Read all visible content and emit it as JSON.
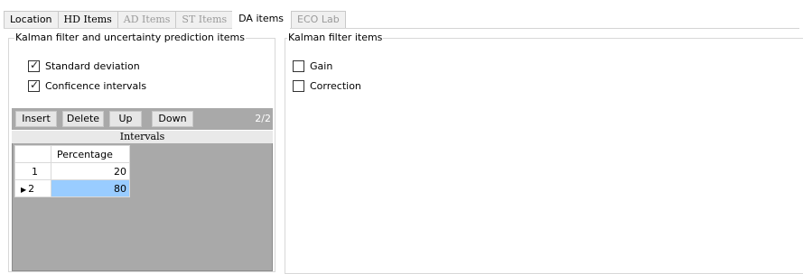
{
  "tabs": [
    {
      "label": "Location",
      "disabled": false,
      "serif": false
    },
    {
      "label": "HD Items",
      "disabled": false,
      "serif": true
    },
    {
      "label": "AD Items",
      "disabled": true,
      "serif": true
    },
    {
      "label": "ST Items",
      "disabled": true,
      "serif": true
    },
    {
      "label": "DA items",
      "disabled": false,
      "serif": false,
      "active": true
    },
    {
      "label": "ECO Lab",
      "disabled": true,
      "serif": false
    }
  ],
  "left_group": {
    "title": "Kalman filter and uncertainty prediction items",
    "checks": [
      {
        "label": "Standard deviation",
        "checked": true
      },
      {
        "label": "Conficence intervals",
        "checked": true
      }
    ]
  },
  "right_group": {
    "title": "Kalman filter items",
    "checks": [
      {
        "label": "Gain",
        "checked": false
      },
      {
        "label": "Correction",
        "checked": false
      }
    ]
  },
  "toolbar": {
    "insert": "Insert",
    "delete": "Delete",
    "up": "Up",
    "down": "Down",
    "count": "2/2"
  },
  "grid": {
    "caption": "Intervals",
    "column": "Percentage",
    "rows": [
      {
        "index": "1",
        "value": "20",
        "selected": false
      },
      {
        "index": "2",
        "value": "80",
        "selected": true
      }
    ]
  },
  "colors": {
    "selection": "#99ccff",
    "toolbar": "#a9a9a9"
  }
}
